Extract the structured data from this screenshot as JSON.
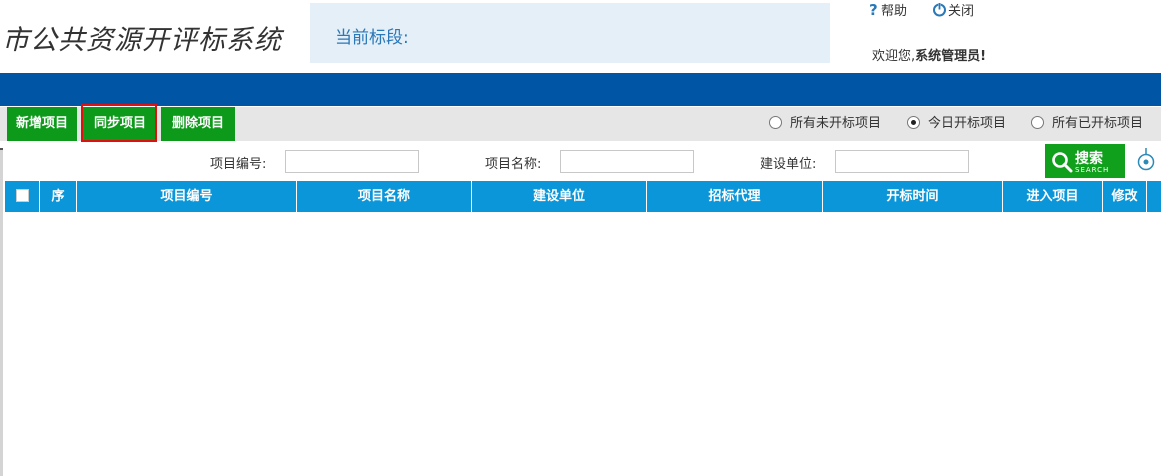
{
  "header": {
    "system_title": "市公共资源开评标系统",
    "stage_label": "当前标段:",
    "help_label": "帮助",
    "close_label": "关闭",
    "welcome_prefix": "欢迎您,",
    "user_name": "系统管理员!"
  },
  "toolbar": {
    "add_label": "新增项目",
    "sync_label": "同步项目",
    "delete_label": "删除项目",
    "filters": [
      {
        "label": "所有未开标项目",
        "selected": false
      },
      {
        "label": "今日开标项目",
        "selected": true
      },
      {
        "label": "所有已开标项目",
        "selected": false
      }
    ]
  },
  "search": {
    "code_label": "项目编号:",
    "code_value": "",
    "name_label": "项目名称:",
    "name_value": "",
    "unit_label": "建设单位:",
    "unit_value": "",
    "button_label": "搜索",
    "button_sub": "SEARCH"
  },
  "grid": {
    "columns": [
      "序",
      "项目编号",
      "项目名称",
      "建设单位",
      "招标代理",
      "开标时间",
      "进入项目",
      "修改"
    ],
    "rows": []
  },
  "colors": {
    "brand_blue": "#0055a5",
    "header_blue": "#0a96d8",
    "green": "#0d9a1a",
    "highlight_red": "#e01010"
  }
}
